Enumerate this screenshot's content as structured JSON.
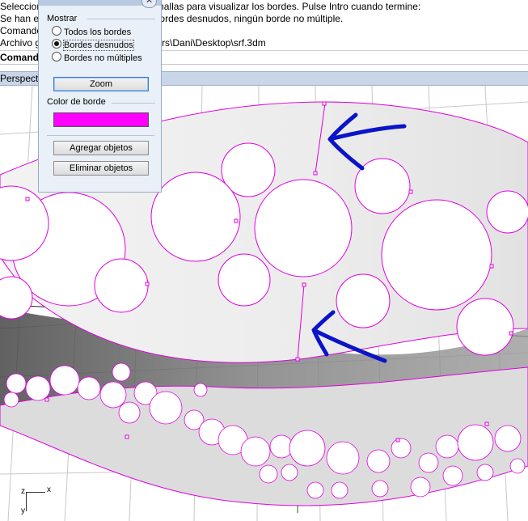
{
  "command_area": {
    "lines": [
      "Seleccion                              ficies o mallas para visualizar los bordes. Pulse Intro cuando termine:",
      "Se han e                               al; 139 bordes desnudos, ningún borde no múltiple.",
      "Comando",
      "Archivo gu                             o C:\\Users\\Dani\\Desktop\\srf.3dm"
    ],
    "prompt": "Comando"
  },
  "viewport": {
    "name": "Perspective",
    "axis_x": "x",
    "axis_y": "y",
    "axis_z": "z"
  },
  "dialog": {
    "close_glyph": "✕",
    "group_show": "Mostrar",
    "radios": [
      {
        "label": "Todos los bordes",
        "checked": false
      },
      {
        "label": "Bordes desnudos",
        "checked": true
      },
      {
        "label": "Bordes no múltiples",
        "checked": false
      }
    ],
    "zoom_label": "Zoom",
    "group_color": "Color de borde",
    "edge_color": "#ff00ff",
    "add_label": "Agregar objetos",
    "remove_label": "Eliminar objetos"
  },
  "colors": {
    "annotation_arrow": "#0a14c8",
    "edge": "#e000e0",
    "viewport_title_bg": "#c9d6e8"
  }
}
